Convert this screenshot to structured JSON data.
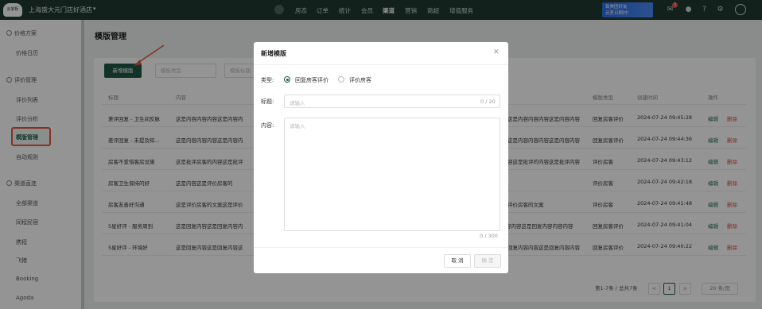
{
  "topbar": {
    "logo": "云掌柜",
    "hotel_name": "上海盛大元门店好酒店",
    "nav": [
      "房态",
      "订单",
      "统计",
      "会员",
      "渠道",
      "营销",
      "商超",
      "增值服务"
    ],
    "active_nav": "渠道",
    "promo_line1": "致美团好友",
    "promo_line2": "还差日期时!",
    "notification_count": "3"
  },
  "sidebar": {
    "sections": [
      {
        "label": "价格方案",
        "items": [
          "价格日历"
        ]
      },
      {
        "label": "评价管理",
        "items": [
          "评价列表",
          "评价分析",
          "模版管理",
          "自动规则"
        ]
      },
      {
        "label": "渠道直连",
        "items": [
          "全部渠道",
          "同程民宿",
          "携程",
          "飞猪",
          "Booking",
          "Agoda"
        ]
      }
    ],
    "active_item": "模版管理"
  },
  "page": {
    "title": "模版管理",
    "new_button": "新增模版",
    "filter_type_placeholder": "模板类型",
    "filter_title_placeholder": "模板标题"
  },
  "table": {
    "headers": [
      "标题",
      "内容",
      "模版类型",
      "创建时间",
      "操作"
    ],
    "rows": [
      {
        "title": "差评回复 - 卫生间反脉",
        "content_left": "这是内容内容内容这是内容内",
        "content_right": "这是内容内容内容这是内容内容",
        "type": "回复房客评价",
        "time": "2024-07-24 09:45:28"
      },
      {
        "title": "差评回复 - 未提及知...",
        "content_left": "这是内容内容内容这是内容内",
        "content_right": "这是内容内容内容这是内容内容",
        "type": "回复房客评价",
        "time": "2024-07-24 09:44:36"
      },
      {
        "title": "房客不爱惜客房设施",
        "content_left": "这是批评房客的内容这是批评",
        "content_right": "容这是批评的内容这是批评内容",
        "type": "评价房客",
        "time": "2024-07-24 09:43:12"
      },
      {
        "title": "房客卫生保持的好",
        "content_left": "这是内容这是评价房客的",
        "content_right": "",
        "type": "评价房客",
        "time": "2024-07-24 09:42:18"
      },
      {
        "title": "房客友善好沟通",
        "content_left": "这是评价房客的文案这是评价",
        "content_right": "评价房客的文案",
        "type": "评价房客",
        "time": "2024-07-24 09:41:48"
      },
      {
        "title": "5星好评 - 服务周到",
        "content_left": "这是回复内容这是回复内容内",
        "content_right": "容内容内容这是回复内容内容内容",
        "type": "回复房客评价",
        "time": "2024-07-24 09:41:04"
      },
      {
        "title": "5星好评 - 环境好",
        "content_left": "这是回复内容这是回复内容这",
        "content_right": "回复内容内容这是回复内容内容",
        "type": "回复房客评价",
        "time": "2024-07-24 09:40:22"
      }
    ],
    "edit_label": "编辑",
    "delete_label": "删除"
  },
  "pagination": {
    "summary": "第1-7条 / 总共7条",
    "prev": "<",
    "current_page": "1",
    "next": ">",
    "page_size": "20 条/页"
  },
  "modal": {
    "title": "新增模版",
    "type_label": "类型:",
    "type_options": [
      "回复房客评价",
      "评价房客"
    ],
    "selected_type": "回复房客评价",
    "title_label": "标题:",
    "title_placeholder": "请输入",
    "title_count": "0 / 20",
    "content_label": "内容:",
    "content_placeholder": "请输入",
    "content_count": "0 / 300",
    "cancel_label": "取 消",
    "confirm_label": "确 定"
  },
  "colors": {
    "topbar": "#1f3a30",
    "primary": "#1f5a45",
    "delete": "#e04a4a",
    "highlight": "#e4573d"
  }
}
